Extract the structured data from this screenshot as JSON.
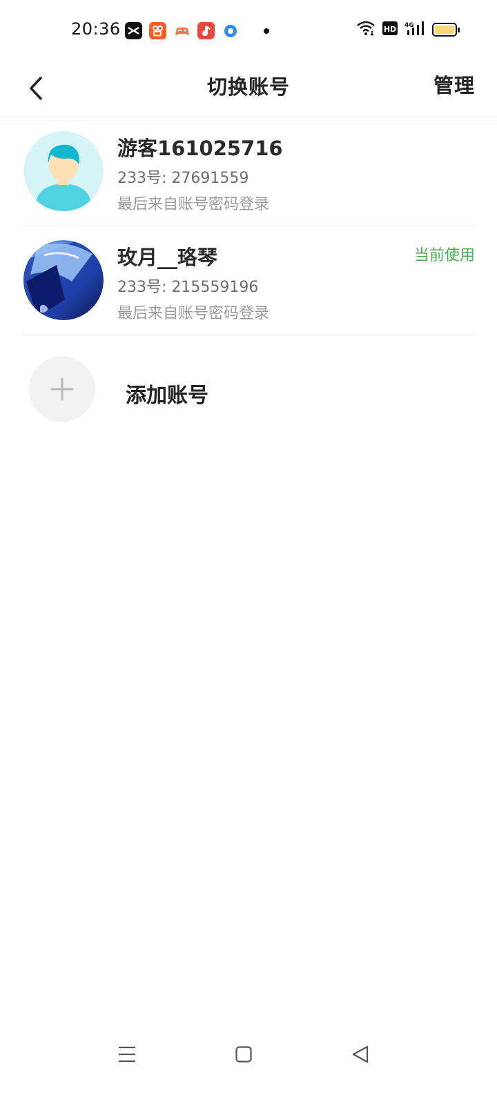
{
  "status_bar": {
    "time": "20:36",
    "network": "4G",
    "hd_label": "HD"
  },
  "nav": {
    "title": "切换账号",
    "manage_label": "管理"
  },
  "accounts": [
    {
      "name": "游客161025716",
      "id_line": "233号: 27691559",
      "login_line": "最后来自账号密码登录",
      "current": false
    },
    {
      "name": "玫月__珞琴",
      "id_line": "233号: 215559196",
      "login_line": "最后来自账号密码登录",
      "current": true,
      "current_label": "当前使用"
    }
  ],
  "add_account": {
    "label": "添加账号"
  },
  "colors": {
    "accent_green": "#4caf50",
    "divider": "#eeeeee",
    "guest_avatar_bg": "#d6f3f6",
    "battery": "#f6d774"
  },
  "icons": {
    "back": "chevron-left-icon",
    "add": "plus-icon",
    "menu": "menu-icon",
    "home": "square-icon",
    "system_back": "triangle-back-icon"
  }
}
